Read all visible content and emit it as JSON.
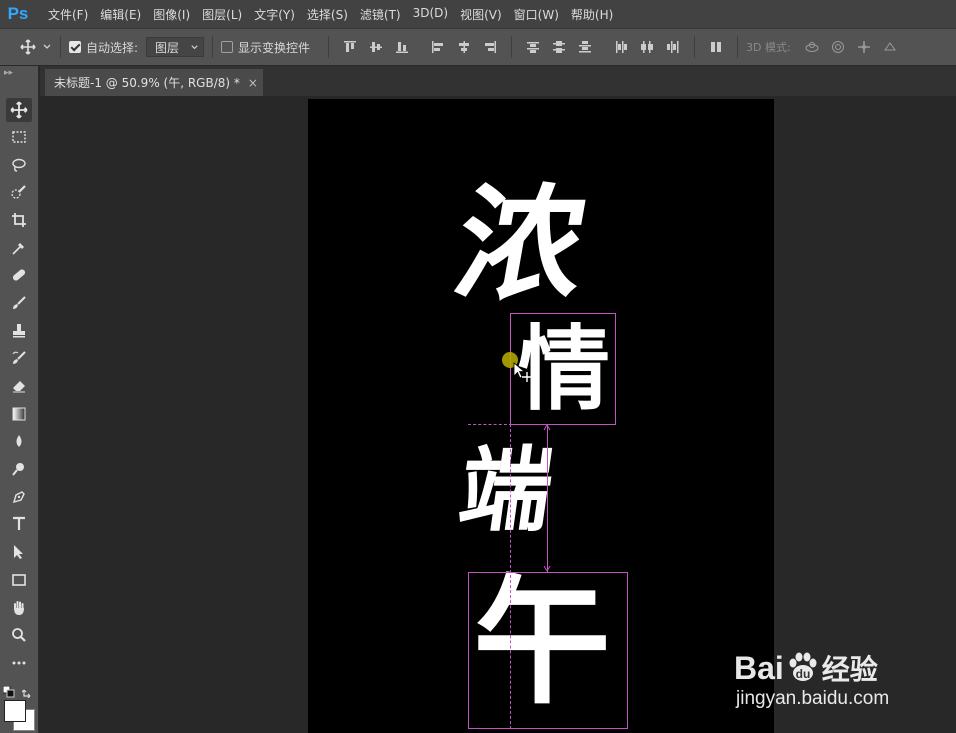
{
  "app": {
    "logo": "Ps"
  },
  "menu": [
    "文件(F)",
    "编辑(E)",
    "图像(I)",
    "图层(L)",
    "文字(Y)",
    "选择(S)",
    "滤镜(T)",
    "3D(D)",
    "视图(V)",
    "窗口(W)",
    "帮助(H)"
  ],
  "options": {
    "auto_select_label": "自动选择:",
    "auto_select_checked": true,
    "layer_select_value": "图层",
    "show_transform_label": "显示变换控件",
    "show_transform_checked": false,
    "mode_3d_label": "3D 模式:"
  },
  "document": {
    "tab_title": "未标题-1 @ 50.9% (午, RGB/8) *",
    "close_glyph": "×"
  },
  "canvas": {
    "characters": [
      "浓",
      "情",
      "端",
      "午"
    ],
    "background": "#000000",
    "selection_color": "#c454c4"
  },
  "watermark": {
    "brand": "Bai",
    "brand_cn": "经验",
    "url": "jingyan.baidu.com"
  },
  "colors": {
    "accent": "#31a8ff",
    "menubar": "#424242",
    "panel": "#535353",
    "workspace": "#282828"
  }
}
